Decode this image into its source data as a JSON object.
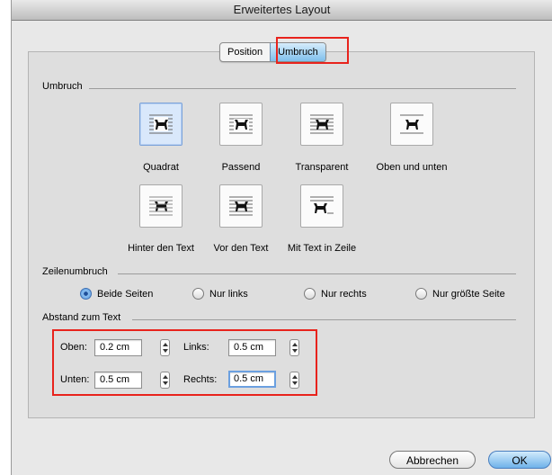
{
  "window": {
    "title": "Erweitertes Layout"
  },
  "tabs": [
    {
      "label": "Position"
    },
    {
      "label": "Umbruch"
    }
  ],
  "umbruch": {
    "heading": "Umbruch",
    "styles": [
      {
        "label": "Quadrat"
      },
      {
        "label": "Passend"
      },
      {
        "label": "Transparent"
      },
      {
        "label": "Oben und unten"
      },
      {
        "label": "Hinter den Text"
      },
      {
        "label": "Vor den Text"
      },
      {
        "label": "Mit Text in Zeile"
      }
    ]
  },
  "zeilenumbruch": {
    "heading": "Zeilenumbruch",
    "options": [
      {
        "label": "Beide Seiten",
        "selected": true
      },
      {
        "label": "Nur links",
        "selected": false
      },
      {
        "label": "Nur rechts",
        "selected": false
      },
      {
        "label": "Nur größte Seite",
        "selected": false
      }
    ]
  },
  "abstand": {
    "heading": "Abstand zum Text",
    "oben": {
      "label": "Oben:",
      "value": "0.2 cm"
    },
    "unten": {
      "label": "Unten:",
      "value": "0.5 cm"
    },
    "links": {
      "label": "Links:",
      "value": "0.5 cm"
    },
    "rechts": {
      "label": "Rechts:",
      "value": "0.5 cm"
    }
  },
  "buttons": {
    "cancel": "Abbrechen",
    "ok": "OK"
  },
  "colors": {
    "highlight": "#e8231c",
    "accent": "#6fb2ea"
  }
}
